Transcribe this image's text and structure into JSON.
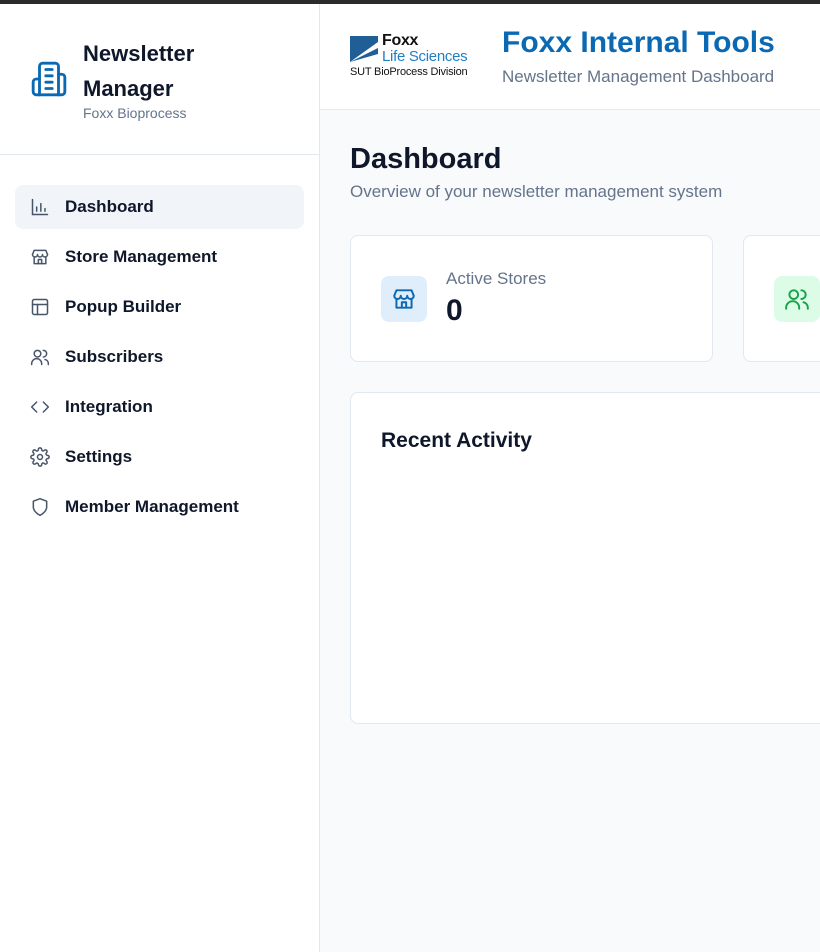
{
  "sidebar": {
    "brand": {
      "title": "Newsletter Manager",
      "subtitle": "Foxx Bioprocess",
      "icon": "building-icon"
    },
    "items": [
      {
        "label": "Dashboard",
        "icon": "bar-chart-icon",
        "active": true
      },
      {
        "label": "Store Management",
        "icon": "store-icon",
        "active": false
      },
      {
        "label": "Popup Builder",
        "icon": "layout-icon",
        "active": false
      },
      {
        "label": "Subscribers",
        "icon": "users-icon",
        "active": false
      },
      {
        "label": "Integration",
        "icon": "code-icon",
        "active": false
      },
      {
        "label": "Settings",
        "icon": "gear-icon",
        "active": false
      },
      {
        "label": "Member Management",
        "icon": "shield-icon",
        "active": false
      }
    ]
  },
  "header": {
    "logo": {
      "line1": "Foxx",
      "line2": "Life Sciences",
      "line3": "SUT BioProcess Division"
    },
    "title": "Foxx Internal Tools",
    "subtitle": "Newsletter Management Dashboard"
  },
  "main": {
    "title": "Dashboard",
    "subtitle": "Overview of your newsletter management system",
    "stats": [
      {
        "label": "Active Stores",
        "value": "0",
        "icon": "store-icon"
      },
      {
        "label": "",
        "value": "",
        "icon": "users-icon"
      }
    ],
    "activity": {
      "title": "Recent Activity"
    }
  },
  "colors": {
    "brand_blue": "#0b69b3",
    "text_primary": "#0f172a",
    "text_muted": "#64748b",
    "active_bg": "#f1f5f9",
    "green_accent": "#16a34a"
  }
}
